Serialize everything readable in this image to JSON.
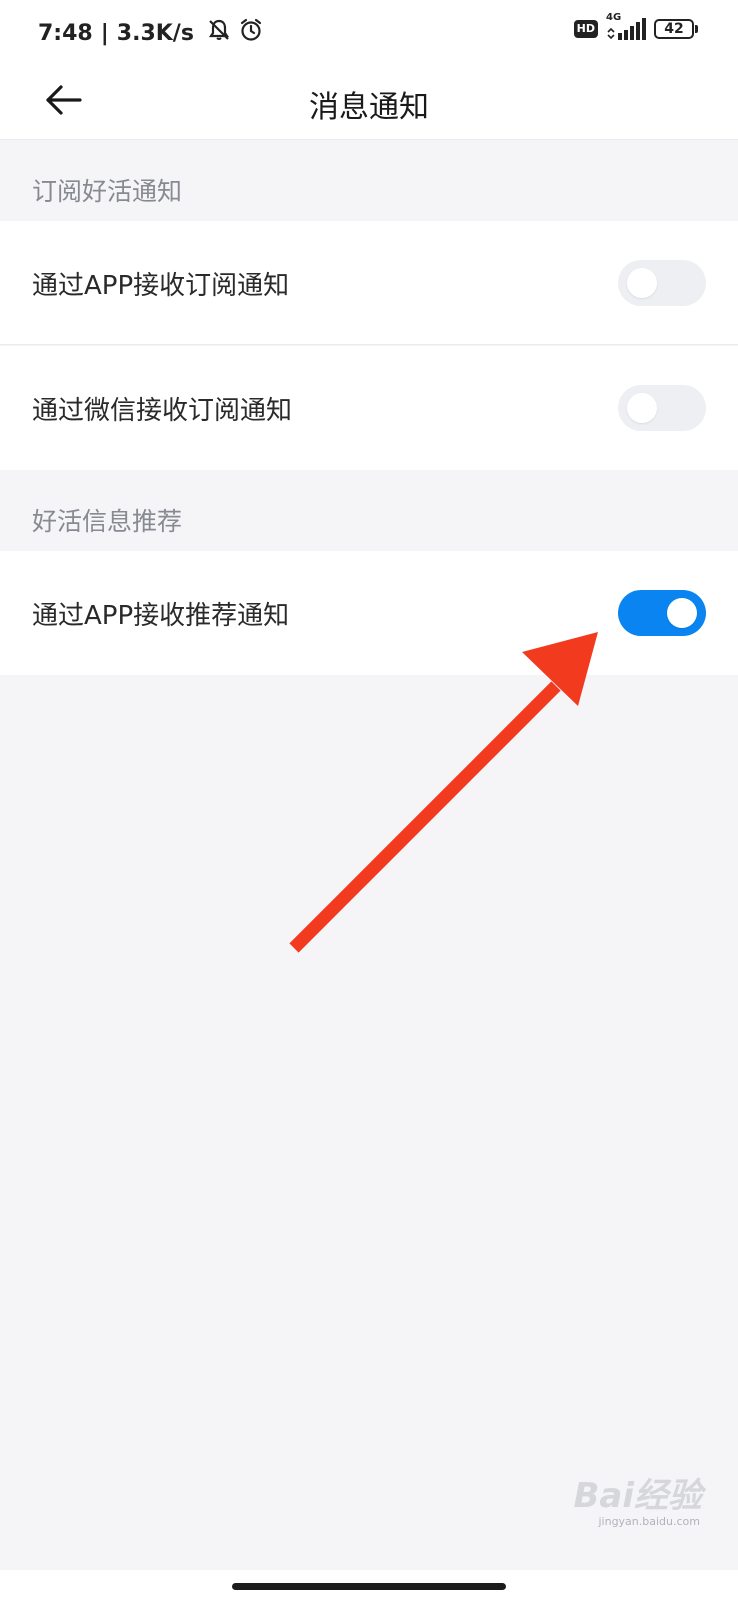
{
  "status_bar": {
    "time": "7:48",
    "separator": "|",
    "speed": "3.3K/s",
    "hd": "HD",
    "network": "4G",
    "battery": "42"
  },
  "header": {
    "title": "消息通知"
  },
  "sections": [
    {
      "title": "订阅好活通知",
      "items": [
        {
          "label": "通过APP接收订阅通知",
          "enabled": false
        },
        {
          "label": "通过微信接收订阅通知",
          "enabled": false
        }
      ]
    },
    {
      "title": "好活信息推荐",
      "items": [
        {
          "label": "通过APP接收推荐通知",
          "enabled": true
        }
      ]
    }
  ],
  "colors": {
    "toggle_on": "#0a84f0",
    "toggle_off": "#eeeff2",
    "annotation_arrow": "#f23a1e"
  },
  "watermark": {
    "logo": "Bai经验",
    "url": "jingyan.baidu.com"
  }
}
